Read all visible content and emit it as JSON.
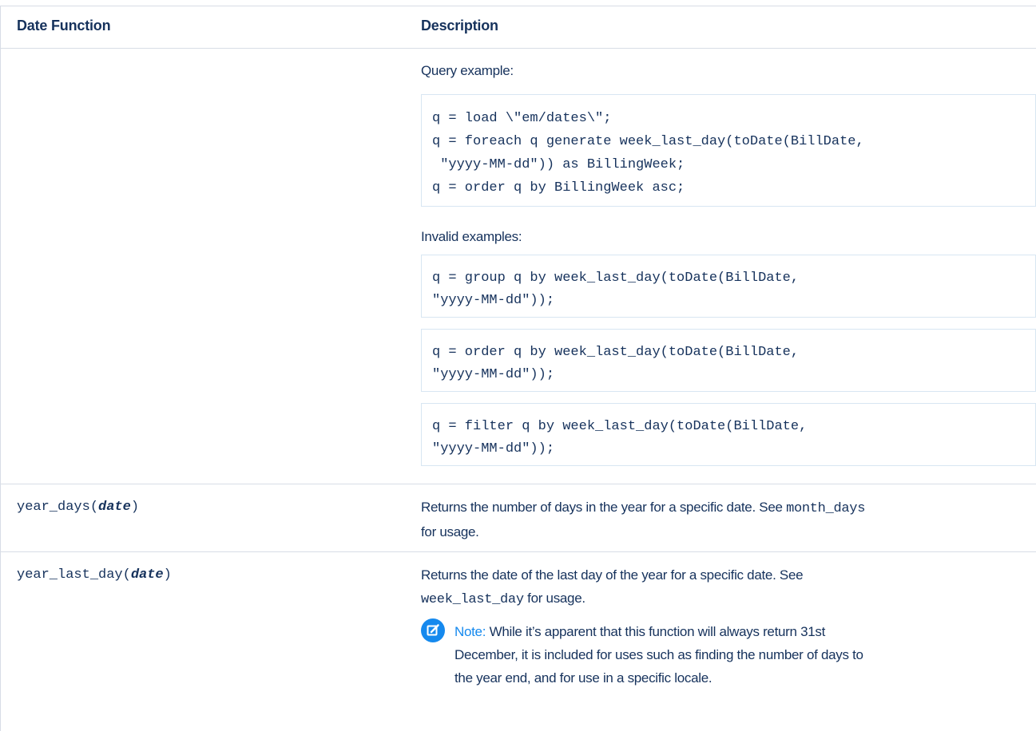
{
  "table": {
    "headers": {
      "date_function": "Date Function",
      "description": "Description"
    }
  },
  "week_last_day_section": {
    "query_example_label": "Query example:",
    "query_example_lines": [
      "q = load \\\"em/dates\\\";",
      "q = foreach q generate week_last_day(toDate(BillDate,",
      " \"yyyy-MM-dd\")) as BillingWeek;",
      "q = order q by BillingWeek asc;"
    ],
    "invalid_examples_label": "Invalid examples:",
    "invalid_examples": [
      [
        "q = group q by week_last_day(toDate(BillDate,",
        "\"yyyy-MM-dd\"));"
      ],
      [
        "q = order q by week_last_day(toDate(BillDate,",
        "\"yyyy-MM-dd\"));"
      ],
      [
        "q = filter q by week_last_day(toDate(BillDate,",
        "\"yyyy-MM-dd\"));"
      ]
    ]
  },
  "year_days_row": {
    "function_name": "year_days(",
    "param": "date",
    "close": ")",
    "desc_text": "Returns the number of days in the year for a specific date. See",
    "desc_code": "month_days",
    "desc_line2": "for usage."
  },
  "year_last_day_row": {
    "function_name": "year_last_day(",
    "param": "date",
    "close": ")",
    "desc_line1": "Returns the date of the last day of the year for a specific date. See",
    "desc_code": "week_last_day",
    "desc_line2_tail": "for usage.",
    "note": {
      "icon": "edit-note-icon",
      "label": "Note:",
      "line1": "While it’s apparent that this function will always return 31st",
      "line2": "December, it is included for uses such as finding the number of days to",
      "line3": "the year end, and for use in a specific locale."
    }
  },
  "colors": {
    "text": "#16325c",
    "accent": "#1589ee",
    "border": "#d8dde6"
  }
}
